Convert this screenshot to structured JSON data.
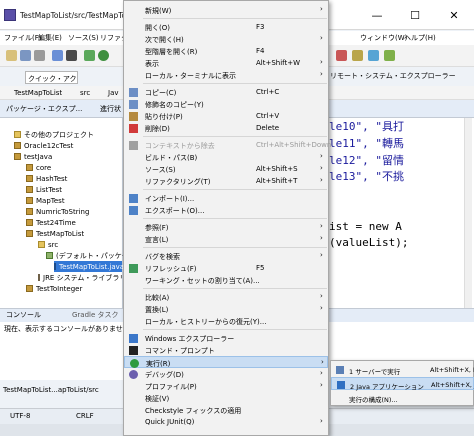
{
  "window": {
    "title": "TestMapToList/src/TestMapToList.ja",
    "minimize": "—",
    "maximize": "☐",
    "close": "✕"
  },
  "menubar": {
    "items": [
      "ファイル(F)",
      "編集(E)",
      "ソース(S)",
      "リファク",
      "ウィンドウ(W)",
      "ヘルプ(H)"
    ]
  },
  "quick_access": {
    "placeholder": "クイック・アクセス"
  },
  "remote_tab": "リモート・システム・エクスプローラー",
  "breadcrumb": [
    "TestMapToList",
    "src",
    "Jav"
  ],
  "package_explorer": {
    "tab_label": "パッケージ・エクスプ...",
    "second_tab": "進行状",
    "tree": [
      {
        "label": "その他のプロジェクト",
        "icon": "folder"
      },
      {
        "label": "Oracle12cTest",
        "icon": "project"
      },
      {
        "label": "testJava",
        "icon": "project"
      },
      {
        "label": "core",
        "icon": "project"
      },
      {
        "label": "HashTest",
        "icon": "project"
      },
      {
        "label": "ListTest",
        "icon": "project"
      },
      {
        "label": "MapTest",
        "icon": "project"
      },
      {
        "label": "NumricToString",
        "icon": "project"
      },
      {
        "label": "Test24Time",
        "icon": "project"
      },
      {
        "label": "TestMapToList",
        "icon": "project"
      },
      {
        "label": "src",
        "icon": "folder"
      },
      {
        "label": "(デフォルト・パッケージ)",
        "icon": "package"
      },
      {
        "label": "TestMapToList.java",
        "icon": "java"
      },
      {
        "label": "JRE システム・ライブラリー [Java",
        "icon": "library"
      },
      {
        "label": "TestToInteger",
        "icon": "project"
      }
    ]
  },
  "editor": {
    "lines": [
      "le10\", \"具打",
      "le11\", \"轉馬",
      "le12\", \"留情",
      "le13\", \"不挑",
      "ist = new A",
      "(valueList);"
    ]
  },
  "console": {
    "tab_label": "コンソール",
    "gradle_tab": "Gradle タスク",
    "message": "現在、表示するコンソールがありません。"
  },
  "bottom_path": "TestMapToList...apToList/src",
  "status": {
    "encoding": "UTF-8",
    "line_ending": "CRLF"
  },
  "context_menu": [
    {
      "label": "新規(W)",
      "shortcut": "",
      "arrow": true,
      "icon": "",
      "disabled": false
    },
    {
      "sep": true
    },
    {
      "label": "開く(O)",
      "shortcut": "F3",
      "arrow": false,
      "icon": "",
      "disabled": false
    },
    {
      "label": "次で開く(H)",
      "shortcut": "",
      "arrow": true,
      "icon": "",
      "disabled": false
    },
    {
      "label": "型階層を開く(R)",
      "shortcut": "F4",
      "arrow": false,
      "icon": "",
      "disabled": false
    },
    {
      "label": "表示",
      "shortcut": "Alt+Shift+W",
      "arrow": true,
      "icon": "",
      "disabled": false
    },
    {
      "label": "ローカル・ターミナルに表示",
      "shortcut": "",
      "arrow": true,
      "icon": "",
      "disabled": false
    },
    {
      "sep": true
    },
    {
      "label": "コピー(C)",
      "shortcut": "Ctrl+C",
      "arrow": false,
      "icon": "copy",
      "disabled": false
    },
    {
      "label": "修飾名のコピー(Y)",
      "shortcut": "",
      "arrow": false,
      "icon": "copy",
      "disabled": false
    },
    {
      "label": "貼り付け(P)",
      "shortcut": "Ctrl+V",
      "arrow": false,
      "icon": "paste",
      "disabled": false
    },
    {
      "label": "削除(D)",
      "shortcut": "Delete",
      "arrow": false,
      "icon": "delete",
      "disabled": false
    },
    {
      "sep": true
    },
    {
      "label": "コンテキストから除去",
      "shortcut": "Ctrl+Alt+Shift+Down",
      "arrow": false,
      "icon": "remove",
      "disabled": true
    },
    {
      "label": "ビルド・パス(B)",
      "shortcut": "",
      "arrow": true,
      "icon": "",
      "disabled": false
    },
    {
      "label": "ソース(S)",
      "shortcut": "Alt+Shift+S",
      "arrow": true,
      "icon": "",
      "disabled": false
    },
    {
      "label": "リファクタリング(T)",
      "shortcut": "Alt+Shift+T",
      "arrow": true,
      "icon": "",
      "disabled": false
    },
    {
      "sep": true
    },
    {
      "label": "インポート(I)...",
      "shortcut": "",
      "arrow": false,
      "icon": "import",
      "disabled": false
    },
    {
      "label": "エクスポート(O)...",
      "shortcut": "",
      "arrow": false,
      "icon": "export",
      "disabled": false
    },
    {
      "sep": true
    },
    {
      "label": "参照(F)",
      "shortcut": "",
      "arrow": true,
      "icon": "",
      "disabled": false
    },
    {
      "label": "宣言(L)",
      "shortcut": "",
      "arrow": true,
      "icon": "",
      "disabled": false
    },
    {
      "sep": true
    },
    {
      "label": "バグを検索",
      "shortcut": "",
      "arrow": true,
      "icon": "",
      "disabled": false
    },
    {
      "label": "リフレッシュ(F)",
      "shortcut": "F5",
      "arrow": false,
      "icon": "refresh",
      "disabled": false
    },
    {
      "label": "ワーキング・セットの割り当て(A)...",
      "shortcut": "",
      "arrow": false,
      "icon": "",
      "disabled": false
    },
    {
      "sep": true
    },
    {
      "label": "比較(A)",
      "shortcut": "",
      "arrow": true,
      "icon": "",
      "disabled": false
    },
    {
      "label": "置換(L)",
      "shortcut": "",
      "arrow": true,
      "icon": "",
      "disabled": false
    },
    {
      "label": "ローカル・ヒストリーからの復元(Y)...",
      "shortcut": "",
      "arrow": false,
      "icon": "",
      "disabled": false
    },
    {
      "sep": true
    },
    {
      "label": "Windows エクスプローラー",
      "shortcut": "",
      "arrow": false,
      "icon": "explorer",
      "disabled": false
    },
    {
      "label": "コマンド・プロンプト",
      "shortcut": "",
      "arrow": false,
      "icon": "cmd",
      "disabled": false
    },
    {
      "label": "実行(R)",
      "shortcut": "",
      "arrow": true,
      "icon": "run",
      "disabled": false,
      "highlight": true
    },
    {
      "label": "デバッグ(D)",
      "shortcut": "",
      "arrow": true,
      "icon": "debug",
      "disabled": false
    },
    {
      "label": "プロファイル(P)",
      "shortcut": "",
      "arrow": true,
      "icon": "",
      "disabled": false
    },
    {
      "label": "検証(V)",
      "shortcut": "",
      "arrow": false,
      "icon": "",
      "disabled": false
    },
    {
      "label": "Checkstyle フィックスの適用",
      "shortcut": "",
      "arrow": false,
      "icon": "",
      "disabled": false
    },
    {
      "label": "Quick JUnit(Q)",
      "shortcut": "",
      "arrow": true,
      "icon": "",
      "disabled": false
    }
  ],
  "run_submenu": [
    {
      "label": "1 サーバーで実行",
      "shortcut": "Alt+Shift+X, R",
      "highlight": false
    },
    {
      "label": "2 Java アプリケーション",
      "shortcut": "Alt+Shift+X, J",
      "highlight": true
    },
    {
      "label": "実行の構成(N)...",
      "shortcut": "",
      "highlight": false
    }
  ]
}
